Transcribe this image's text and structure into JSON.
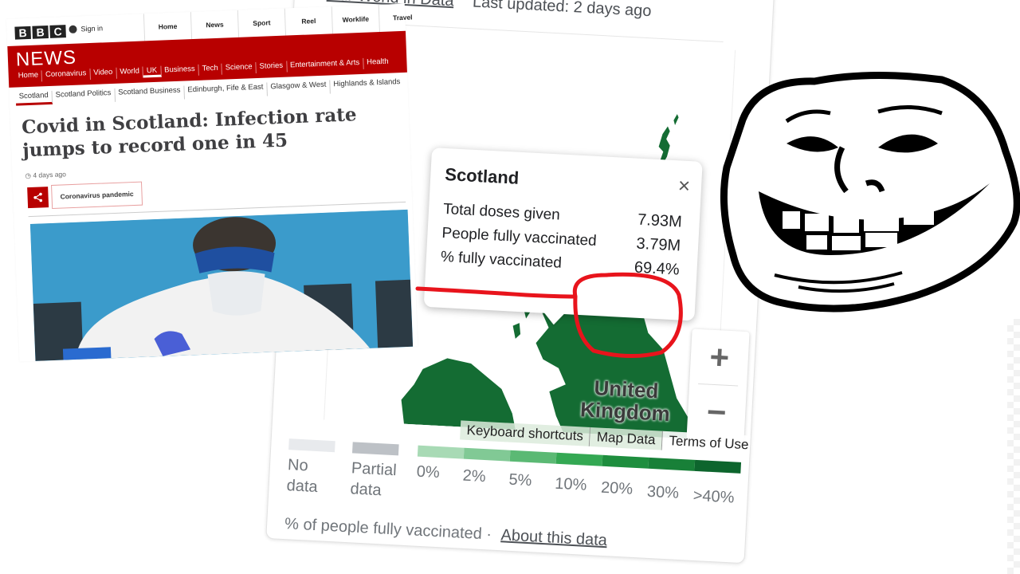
{
  "google_panel": {
    "source_link": "Our World in Data",
    "last_updated": "Last updated: 2 days ago",
    "map": {
      "country_label_line1": "United",
      "country_label_line2": "Kingdom",
      "fill_color": "#146c33",
      "zoom_in_label": "+",
      "zoom_out_label": "−",
      "attribution": [
        "Keyboard shortcuts",
        "Map Data",
        "Terms of Use"
      ]
    },
    "popup": {
      "title": "Scotland",
      "close_label": "×",
      "rows": [
        {
          "label": "Total doses given",
          "value": "7.93M"
        },
        {
          "label": "People fully vaccinated",
          "value": "3.79M"
        },
        {
          "label": "% fully vaccinated",
          "value": "69.4%"
        }
      ]
    },
    "legend": {
      "no_data_line1": "No",
      "no_data_line2": "data",
      "partial_line1": "Partial",
      "partial_line2": "data",
      "no_data_color": "#e8eaed",
      "partial_color": "#bdc1c6",
      "scale_colors": [
        "#a8dab5",
        "#81c995",
        "#5bb974",
        "#34a853",
        "#1e8e3e",
        "#188038",
        "#0d652d"
      ],
      "ticks": [
        "0%",
        "2%",
        "5%",
        "10%",
        "20%",
        "30%",
        ">40%"
      ]
    },
    "footer_text": "% of people fully vaccinated",
    "footer_sep": "·",
    "about_link": "About this data"
  },
  "bbc": {
    "logo_letters": [
      "B",
      "B",
      "C"
    ],
    "sign_in": "Sign in",
    "top_nav": [
      "Home",
      "News",
      "Sport",
      "Reel",
      "Worklife",
      "Travel"
    ],
    "brand": "NEWS",
    "menu": [
      "Home",
      "Coronavirus",
      "Video",
      "World",
      "UK",
      "Business",
      "Tech",
      "Science",
      "Stories",
      "Entertainment & Arts",
      "Health"
    ],
    "menu_active": "UK",
    "submenu": [
      "Scotland",
      "Scotland Politics",
      "Scotland Business",
      "Edinburgh, Fife & East",
      "Glasgow & West",
      "Highlands & Islands"
    ],
    "submenu_active": "Scotland",
    "headline": "Covid in Scotland: Infection rate jumps to record one in 45",
    "timestamp": "4 days ago",
    "share_icon": "<",
    "tag": "Coronavirus pandemic",
    "brand_color": "#b80000"
  },
  "annotation": {
    "color": "#e8141c",
    "highlighted_value": "69.4%"
  },
  "meme": {
    "name": "troll face"
  }
}
